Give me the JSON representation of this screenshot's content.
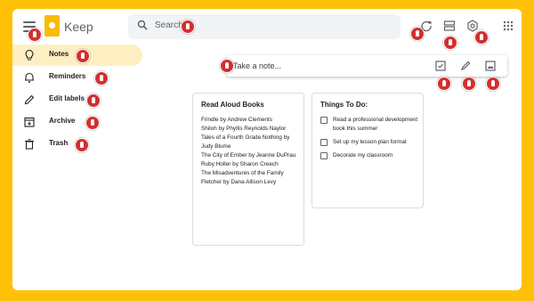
{
  "header": {
    "app_title": "Keep",
    "search_placeholder": "Search",
    "icons": [
      "menu-icon",
      "keep-logo",
      "search-icon",
      "refresh-icon",
      "list-view-icon",
      "settings-icon",
      "apps-icon"
    ]
  },
  "sidebar": {
    "items": [
      {
        "label": "Notes",
        "icon": "lightbulb-icon",
        "active": true
      },
      {
        "label": "Reminders",
        "icon": "bell-icon",
        "active": false
      },
      {
        "label": "Edit labels",
        "icon": "pencil-icon",
        "active": false
      },
      {
        "label": "Archive",
        "icon": "archive-icon",
        "active": false
      },
      {
        "label": "Trash",
        "icon": "trash-icon",
        "active": false
      }
    ]
  },
  "take_note": {
    "placeholder": "Take a note...",
    "icons": [
      "checkbox-icon",
      "brush-icon",
      "image-icon"
    ]
  },
  "notes": [
    {
      "title": "Read Aloud Books",
      "lines": [
        "Frindle by Andrew Clements",
        "Shiloh by Phyllis Reynolds Naylor",
        "Tales of a Fourth Grade Nothing by Judy Blume",
        "The City of Ember by Jeanne DuPrau",
        "Ruby Holler by Sharon Creech",
        "The Misadventures of the Family Fletcher by Dana Allison Levy"
      ]
    },
    {
      "title": "Things To Do:",
      "items": [
        "Read a professional development book this summer",
        "Set up my lesson plan format",
        "Decorate my classroom"
      ]
    }
  ],
  "colors": {
    "background": "#FFC107",
    "active_nav": "#feefc3",
    "touch_marker": "#D32F2F",
    "logo": "#F9BB05"
  }
}
